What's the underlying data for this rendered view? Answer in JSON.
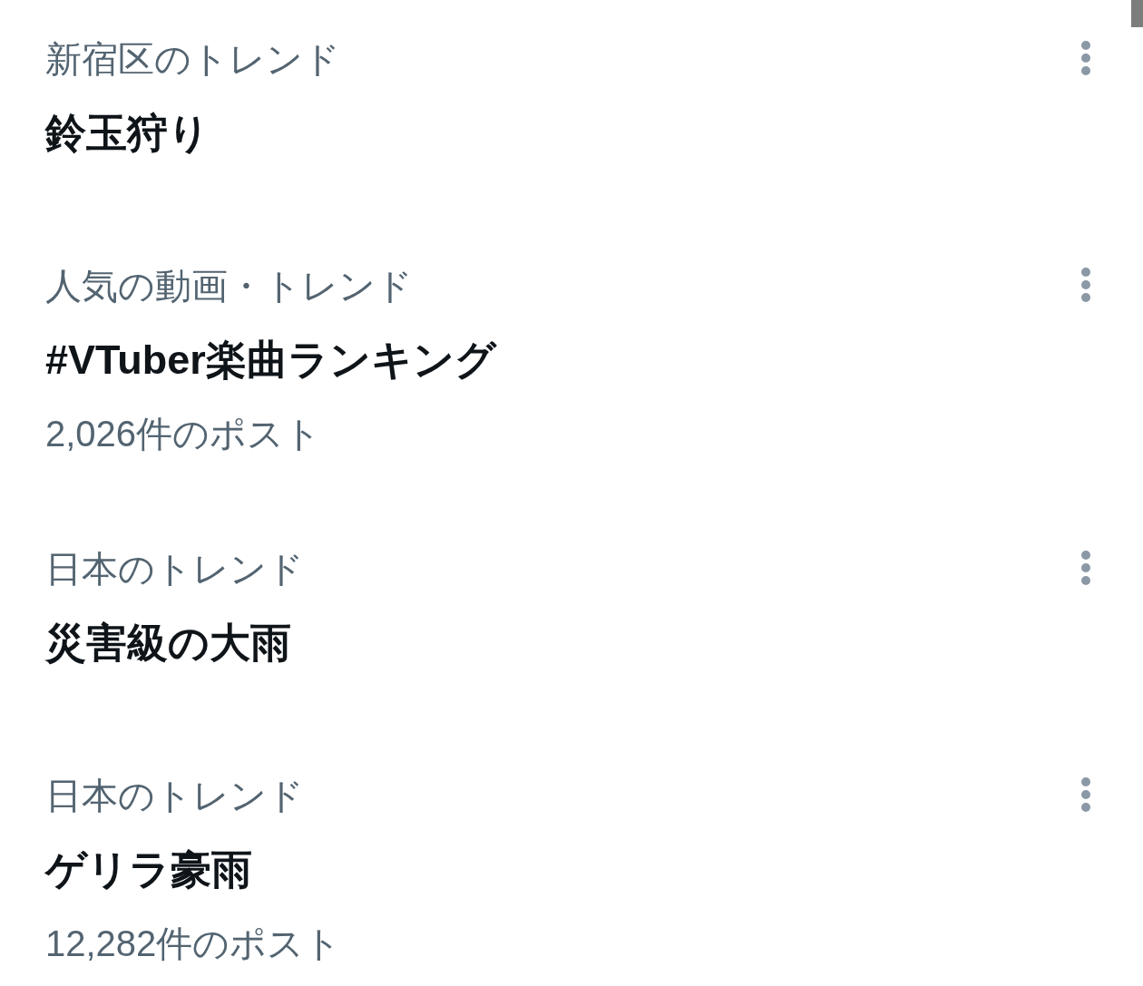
{
  "trends": [
    {
      "context": "新宿区のトレンド",
      "title": "鈴玉狩り"
    },
    {
      "context": "人気の動画・トレンド",
      "title": "#VTuber楽曲ランキング",
      "post_count": "2,026件のポスト"
    },
    {
      "context": "日本のトレンド",
      "title": "災害級の大雨"
    },
    {
      "context": "日本のトレンド",
      "title": "ゲリラ豪雨",
      "post_count": "12,282件のポスト"
    }
  ]
}
